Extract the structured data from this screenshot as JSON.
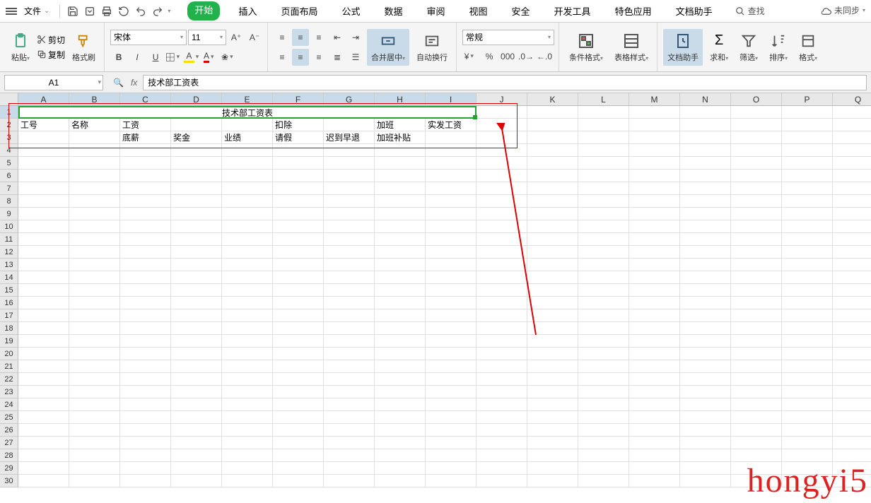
{
  "menubar": {
    "file": "文件",
    "tabs": [
      "开始",
      "插入",
      "页面布局",
      "公式",
      "数据",
      "审阅",
      "视图",
      "安全",
      "开发工具",
      "特色应用",
      "文档助手"
    ],
    "search": "查找",
    "sync": "未同步"
  },
  "ribbon": {
    "paste": "粘贴",
    "cut": "剪切",
    "copy": "复制",
    "format_painter": "格式刷",
    "font_name": "宋体",
    "font_size": "11",
    "merge_center": "合并居中",
    "wrap_text": "自动换行",
    "number_format": "常规",
    "cond_format": "条件格式",
    "table_style": "表格样式",
    "doc_helper": "文档助手",
    "sum": "求和",
    "filter": "筛选",
    "sort": "排序",
    "format": "格式"
  },
  "fbar": {
    "namebox": "A1",
    "formula": "技术部工资表"
  },
  "columns": [
    "A",
    "B",
    "C",
    "D",
    "E",
    "F",
    "G",
    "H",
    "I",
    "J",
    "K",
    "L",
    "M",
    "N",
    "O",
    "P",
    "Q"
  ],
  "rows": [
    "1",
    "2",
    "3",
    "4",
    "5",
    "6",
    "7",
    "8",
    "9",
    "10",
    "11",
    "12",
    "13",
    "14",
    "15",
    "16",
    "17",
    "18",
    "19",
    "20",
    "21",
    "22",
    "23",
    "24",
    "25",
    "26",
    "27",
    "28",
    "29",
    "30"
  ],
  "sheet": {
    "title": "技术部工资表",
    "r2": {
      "A": "工号",
      "B": "名称",
      "C": "工资",
      "F": "扣除",
      "H": "加班",
      "I": "实发工资"
    },
    "r3": {
      "C": "底薪",
      "D": "奖金",
      "E": "业绩",
      "F": "请假",
      "G": "迟到早退",
      "H": "加班补贴"
    }
  },
  "watermark": "hongyi5"
}
